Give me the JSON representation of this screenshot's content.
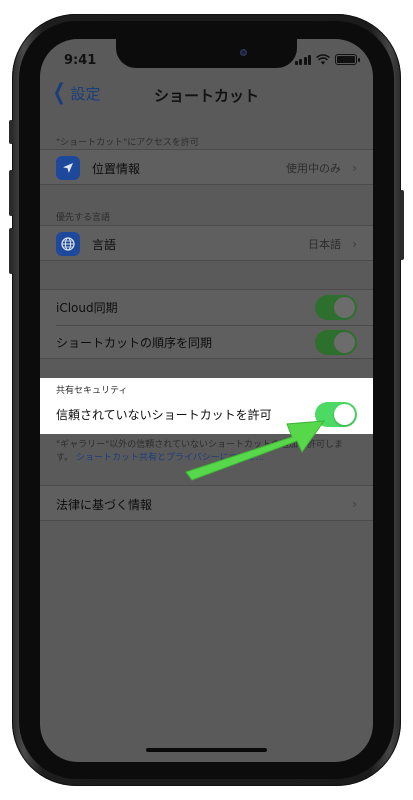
{
  "status_bar": {
    "time": "9:41"
  },
  "nav": {
    "back_label": "設定",
    "title": "ショートカット"
  },
  "access_section": {
    "header": "\"ショートカット\"にアクセスを許可",
    "location": {
      "label": "位置情報",
      "value": "使用中のみ",
      "icon": "location-arrow-icon"
    }
  },
  "language_section": {
    "header": "優先する言語",
    "language": {
      "label": "言語",
      "value": "日本語",
      "icon": "globe-icon"
    }
  },
  "sync_section": {
    "icloud_sync": {
      "label": "iCloud同期",
      "on": true
    },
    "order_sync": {
      "label": "ショートカットの順序を同期",
      "on": true
    }
  },
  "security_section": {
    "header": "共有セキュリティ",
    "untrusted": {
      "label": "信頼されていないショートカットを許可",
      "on": true
    },
    "footer_text": "\"ギャラリー\"以外の信頼されていないショートカットの追加を許可しま す。",
    "footer_link": "ショートカット共有とプライバシーについて..."
  },
  "legal": {
    "label": "法律に基づく情報"
  },
  "colors": {
    "accent_green": "#4cd964",
    "arrow_green": "#57d84a",
    "link_blue": "#1b3d7a"
  }
}
